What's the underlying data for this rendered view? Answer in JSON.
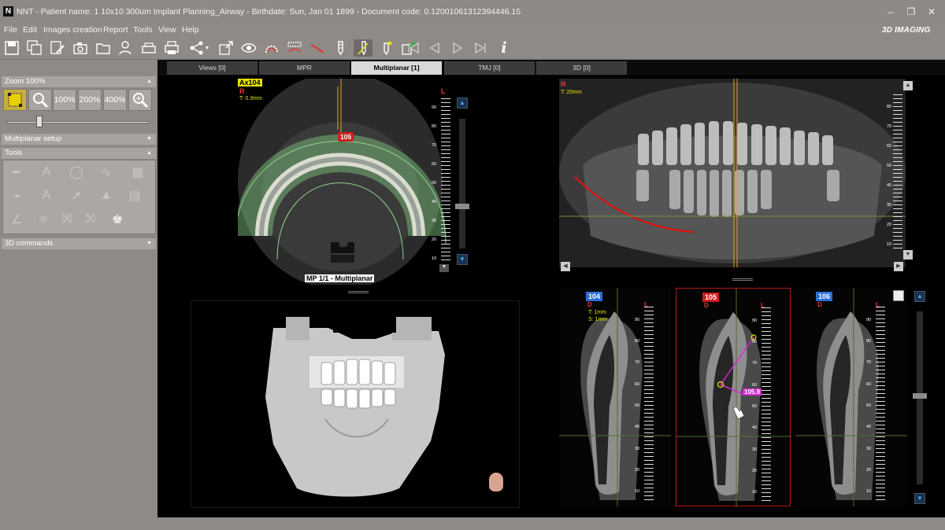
{
  "window": {
    "app_letter": "N",
    "title": "NNT - Patient name: 1 10x10 300um Implant Planning_Airway - Birthdate: Sun, Jan 01 1899 - Document code: 0.12001061312394446.15",
    "brand": "3D IMAGING",
    "min_icon": "minimize-icon",
    "max_icon": "restore-icon",
    "close_icon": "close-icon"
  },
  "menu": [
    "File",
    "Edit",
    "Images creation",
    "Report",
    "Tools",
    "View",
    "Help"
  ],
  "toolbar_icons": [
    "save-icon",
    "save-all-icon",
    "edit-doc-icon",
    "camera-icon",
    "folder-icon",
    "patient-icon",
    "scanner-icon",
    "print-icon",
    "share-icon",
    "export-icon",
    "eye-icon",
    "nerve-icon",
    "panoramic-curve-icon",
    "canal-icon",
    "implant-icon",
    "implant-measure-icon",
    "implant-active-icon",
    "green-export-icon",
    "first-icon",
    "prev-icon",
    "play-icon",
    "last-icon",
    "info-icon"
  ],
  "left_panel": {
    "zoom_header": "Zoom 100%",
    "zoom_buttons": [
      "100%",
      "200%",
      "400%"
    ],
    "slider_value": 0.2,
    "multiplanar_header": "Multiplanar setup",
    "tools_header": "Tools",
    "commands_header": "3D commands"
  },
  "tabs": [
    "Views [0]",
    "MPR",
    "Multiplanar [1]",
    "TMJ [0]",
    "3D [0]"
  ],
  "selected_tab": "Multiplanar [1]",
  "axial": {
    "series_label": "Ax104",
    "orientation_r": "R",
    "orientation_l": "L",
    "thickness": "T: 0.3mm",
    "marker": "105",
    "caption": "MP 1/1 - Multiplanar",
    "ruler_ticks": [
      "90",
      "80",
      "70",
      "60",
      "50",
      "40",
      "30",
      "20",
      "10"
    ]
  },
  "panoramic": {
    "orientation_r": "R",
    "thickness": "T: 20mm",
    "ruler_ticks": [
      "80",
      "70",
      "60",
      "50",
      "40",
      "30",
      "20",
      "10"
    ]
  },
  "cross_sections": [
    {
      "slice": "104",
      "color": "#2a6fd6",
      "d": "D",
      "l": "L",
      "t": "T: 1mm",
      "s": "S: 1mm"
    },
    {
      "slice": "105",
      "color": "#cc1f1f",
      "d": "D",
      "l": "L",
      "measure": "105.9"
    },
    {
      "slice": "106",
      "color": "#2a6fd6",
      "d": "D",
      "l": "L"
    }
  ],
  "cross_ruler_ticks": [
    "90",
    "80",
    "70",
    "60",
    "50",
    "40",
    "30",
    "20",
    "10"
  ],
  "colors": {
    "accent_red": "#cc1f1f",
    "accent_blue": "#2a6fd6",
    "label_yellow": "#e8e400"
  }
}
